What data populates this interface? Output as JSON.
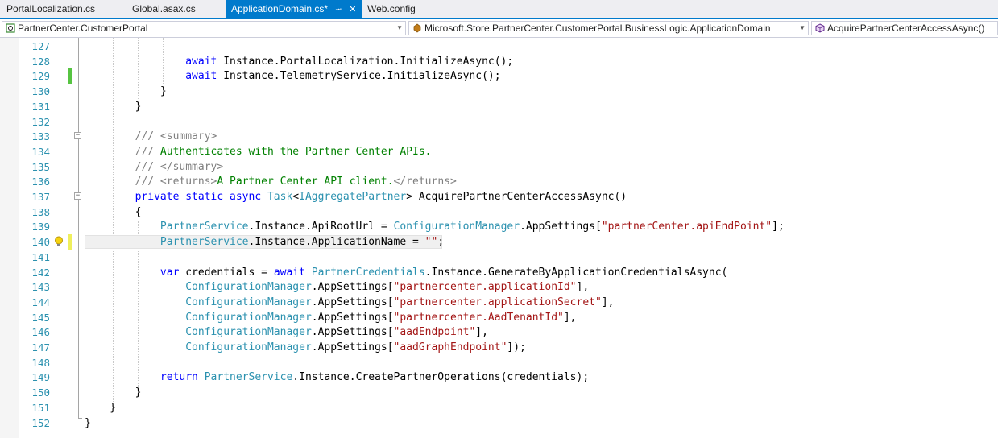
{
  "tabs": [
    {
      "label": "PortalLocalization.cs",
      "active": false
    },
    {
      "label": "Global.asax.cs",
      "active": false
    },
    {
      "label": "ApplicationDomain.cs*",
      "active": true,
      "pin_icon": "pin-icon",
      "close_icon": "close-icon"
    },
    {
      "label": "Web.config",
      "active": false
    }
  ],
  "navbar": {
    "project": "PartnerCenter.CustomerPortal",
    "type": "Microsoft.Store.PartnerCenter.CustomerPortal.BusinessLogic.ApplicationDomain",
    "member": "AcquirePartnerCenterAccessAsync()"
  },
  "colors": {
    "accent": "#007acc",
    "keyword": "#0000ff",
    "type": "#2b91af",
    "string": "#a31515",
    "comment": "#008000",
    "line_number": "#2b91af",
    "saved_change": "#57c442",
    "unsaved_change": "#efef5d"
  },
  "code": {
    "lines": [
      {
        "num": "127",
        "tokens": []
      },
      {
        "num": "128",
        "tokens": [
          {
            "t": "                await ",
            "c": "kw"
          },
          {
            "t": "Instance.PortalLocalization.InitializeAsync();",
            "c": ""
          }
        ]
      },
      {
        "num": "129",
        "tokens": [
          {
            "t": "                await ",
            "c": "kw"
          },
          {
            "t": "Instance.TelemetryService.InitializeAsync();",
            "c": ""
          }
        ]
      },
      {
        "num": "130",
        "tokens": [
          {
            "t": "            }",
            "c": ""
          }
        ]
      },
      {
        "num": "131",
        "tokens": [
          {
            "t": "        }",
            "c": ""
          }
        ]
      },
      {
        "num": "132",
        "tokens": []
      },
      {
        "num": "133",
        "tokens": [
          {
            "t": "        /// ",
            "c": "cg"
          },
          {
            "t": "<summary>",
            "c": "cg"
          }
        ]
      },
      {
        "num": "134",
        "tokens": [
          {
            "t": "        /// ",
            "c": "cg"
          },
          {
            "t": "Authenticates with the Partner Center APIs.",
            "c": "cm"
          }
        ]
      },
      {
        "num": "135",
        "tokens": [
          {
            "t": "        /// ",
            "c": "cg"
          },
          {
            "t": "</summary>",
            "c": "cg"
          }
        ]
      },
      {
        "num": "136",
        "tokens": [
          {
            "t": "        /// ",
            "c": "cg"
          },
          {
            "t": "<returns>",
            "c": "cg"
          },
          {
            "t": "A Partner Center API client.",
            "c": "cm"
          },
          {
            "t": "</returns>",
            "c": "cg"
          }
        ]
      },
      {
        "num": "137",
        "tokens": [
          {
            "t": "        private static async ",
            "c": "kw"
          },
          {
            "t": "Task",
            "c": "ty"
          },
          {
            "t": "<",
            "c": ""
          },
          {
            "t": "IAggregatePartner",
            "c": "ty"
          },
          {
            "t": "> AcquirePartnerCenterAccessAsync()",
            "c": ""
          }
        ]
      },
      {
        "num": "138",
        "tokens": [
          {
            "t": "        {",
            "c": ""
          }
        ]
      },
      {
        "num": "139",
        "tokens": [
          {
            "t": "            ",
            "c": ""
          },
          {
            "t": "PartnerService",
            "c": "ty"
          },
          {
            "t": ".Instance.ApiRootUrl = ",
            "c": ""
          },
          {
            "t": "ConfigurationManager",
            "c": "ty"
          },
          {
            "t": ".AppSettings[",
            "c": ""
          },
          {
            "t": "\"partnerCenter.apiEndPoint\"",
            "c": "st"
          },
          {
            "t": "];",
            "c": ""
          }
        ]
      },
      {
        "num": "140",
        "tokens": [
          {
            "t": "            ",
            "c": ""
          },
          {
            "t": "PartnerService",
            "c": "ty"
          },
          {
            "t": ".Instance.ApplicationName = ",
            "c": ""
          },
          {
            "t": "\"\"",
            "c": "st"
          },
          {
            "t": ";",
            "c": ""
          }
        ]
      },
      {
        "num": "141",
        "tokens": []
      },
      {
        "num": "142",
        "tokens": [
          {
            "t": "            var ",
            "c": "kw"
          },
          {
            "t": "credentials = ",
            "c": ""
          },
          {
            "t": "await ",
            "c": "kw"
          },
          {
            "t": "PartnerCredentials",
            "c": "ty"
          },
          {
            "t": ".Instance.GenerateByApplicationCredentialsAsync(",
            "c": ""
          }
        ]
      },
      {
        "num": "143",
        "tokens": [
          {
            "t": "                ",
            "c": ""
          },
          {
            "t": "ConfigurationManager",
            "c": "ty"
          },
          {
            "t": ".AppSettings[",
            "c": ""
          },
          {
            "t": "\"partnercenter.applicationId\"",
            "c": "st"
          },
          {
            "t": "],",
            "c": ""
          }
        ]
      },
      {
        "num": "144",
        "tokens": [
          {
            "t": "                ",
            "c": ""
          },
          {
            "t": "ConfigurationManager",
            "c": "ty"
          },
          {
            "t": ".AppSettings[",
            "c": ""
          },
          {
            "t": "\"partnercenter.applicationSecret\"",
            "c": "st"
          },
          {
            "t": "],",
            "c": ""
          }
        ]
      },
      {
        "num": "145",
        "tokens": [
          {
            "t": "                ",
            "c": ""
          },
          {
            "t": "ConfigurationManager",
            "c": "ty"
          },
          {
            "t": ".AppSettings[",
            "c": ""
          },
          {
            "t": "\"partnercenter.AadTenantId\"",
            "c": "st"
          },
          {
            "t": "],",
            "c": ""
          }
        ]
      },
      {
        "num": "146",
        "tokens": [
          {
            "t": "                ",
            "c": ""
          },
          {
            "t": "ConfigurationManager",
            "c": "ty"
          },
          {
            "t": ".AppSettings[",
            "c": ""
          },
          {
            "t": "\"aadEndpoint\"",
            "c": "st"
          },
          {
            "t": "],",
            "c": ""
          }
        ]
      },
      {
        "num": "147",
        "tokens": [
          {
            "t": "                ",
            "c": ""
          },
          {
            "t": "ConfigurationManager",
            "c": "ty"
          },
          {
            "t": ".AppSettings[",
            "c": ""
          },
          {
            "t": "\"aadGraphEndpoint\"",
            "c": "st"
          },
          {
            "t": "]);",
            "c": ""
          }
        ]
      },
      {
        "num": "148",
        "tokens": []
      },
      {
        "num": "149",
        "tokens": [
          {
            "t": "            return ",
            "c": "kw"
          },
          {
            "t": "PartnerService",
            "c": "ty"
          },
          {
            "t": ".Instance.CreatePartnerOperations(credentials);",
            "c": ""
          }
        ]
      },
      {
        "num": "150",
        "tokens": [
          {
            "t": "        }",
            "c": ""
          }
        ]
      },
      {
        "num": "151",
        "tokens": [
          {
            "t": "    }",
            "c": ""
          }
        ]
      },
      {
        "num": "152",
        "tokens": [
          {
            "t": "}",
            "c": ""
          }
        ]
      }
    ]
  }
}
